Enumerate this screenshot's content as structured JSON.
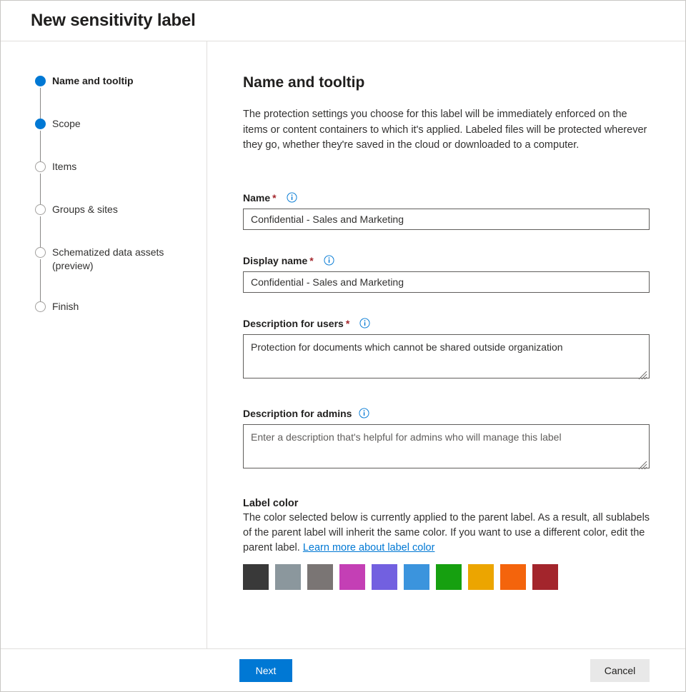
{
  "window": {
    "title": "New sensitivity label"
  },
  "steps": [
    {
      "label": "Name and tooltip",
      "state": "current"
    },
    {
      "label": "Scope",
      "state": "done"
    },
    {
      "label": "Items",
      "state": "todo"
    },
    {
      "label": "Groups & sites",
      "state": "todo"
    },
    {
      "label": "Schematized data assets (preview)",
      "state": "todo"
    },
    {
      "label": "Finish",
      "state": "todo"
    }
  ],
  "main": {
    "heading": "Name and tooltip",
    "description": "The protection settings you choose for this label will be immediately enforced on the items or content containers to which it's applied. Labeled files will be protected wherever they go, whether they're saved in the cloud or downloaded to a computer.",
    "fields": {
      "name": {
        "label": "Name",
        "required_marker": "*",
        "info_icon": "info-icon",
        "value": "Confidential - Sales and Marketing",
        "placeholder": ""
      },
      "display_name": {
        "label": "Display name",
        "required_marker": "*",
        "info_icon": "info-icon",
        "value": "Confidential - Sales and Marketing",
        "placeholder": ""
      },
      "description_users": {
        "label": "Description for users",
        "required_marker": "*",
        "info_icon": "info-icon",
        "value": "Protection for documents which cannot be shared outside organization",
        "placeholder": ""
      },
      "description_admins": {
        "label": "Description for admins",
        "required_marker": "",
        "info_icon": "info-icon",
        "value": "",
        "placeholder": "Enter a description that's helpful for admins who will manage this label"
      }
    },
    "label_color": {
      "heading": "Label color",
      "description": "The color selected below is currently applied to the parent label. As a result, all sublabels of the parent label will inherit the same color. If you want to use a different color, edit the parent label.",
      "link_text": "Learn more about label color",
      "swatches": [
        {
          "name": "charcoal",
          "hex": "#393939"
        },
        {
          "name": "blue-gray",
          "hex": "#8b979d"
        },
        {
          "name": "gray",
          "hex": "#7a7574"
        },
        {
          "name": "magenta",
          "hex": "#c43fb5"
        },
        {
          "name": "purple",
          "hex": "#7260e0"
        },
        {
          "name": "blue",
          "hex": "#3b94dd"
        },
        {
          "name": "green",
          "hex": "#16a010"
        },
        {
          "name": "amber",
          "hex": "#eca500"
        },
        {
          "name": "orange",
          "hex": "#f4640c"
        },
        {
          "name": "dark-red",
          "hex": "#a3252c"
        }
      ]
    }
  },
  "footer": {
    "next_label": "Next",
    "cancel_label": "Cancel"
  },
  "colors": {
    "accent": "#0078d4",
    "required": "#a4262c",
    "text": "#323130",
    "border": "#605e5c",
    "divider": "#e1dfdd"
  }
}
